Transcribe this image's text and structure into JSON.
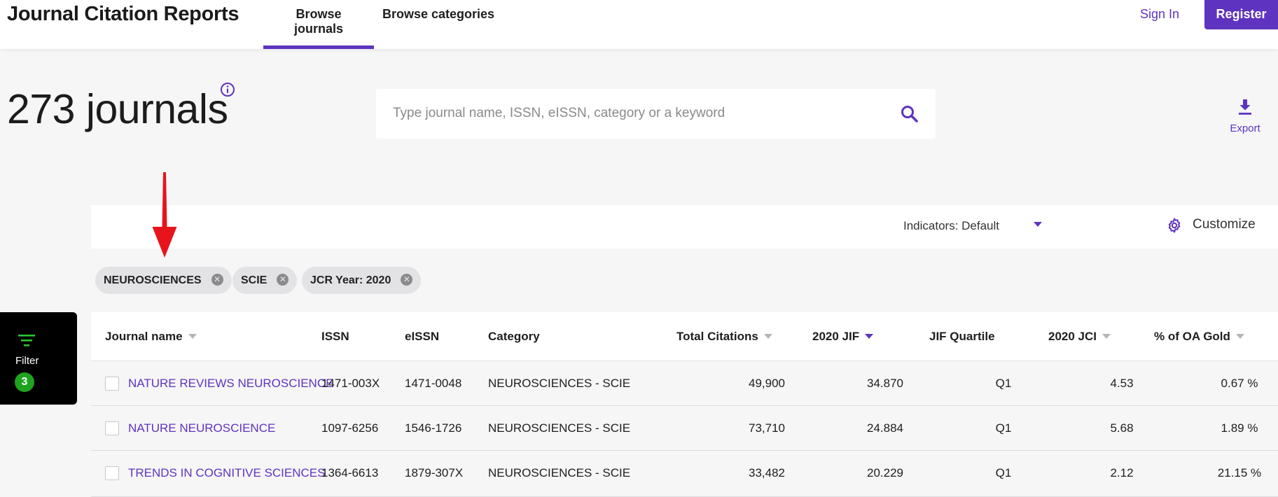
{
  "header": {
    "brand": "Journal Citation Reports",
    "tabs": [
      {
        "label": "Browse journals",
        "active": true
      },
      {
        "label": "Browse categories",
        "active": false
      }
    ],
    "sign_in": "Sign In",
    "register": "Register"
  },
  "title": {
    "count": "273 journals",
    "info_icon": "info-icon"
  },
  "search": {
    "placeholder": "Type journal name, ISSN, eISSN, category or a keyword",
    "value": ""
  },
  "export": {
    "label": "Export",
    "icon": "download-icon"
  },
  "toolbar": {
    "indicators": "Indicators: Default",
    "customize": "Customize"
  },
  "chips": [
    {
      "label": "NEUROSCIENCES"
    },
    {
      "label": "SCIE"
    },
    {
      "label": "JCR Year: 2020"
    }
  ],
  "filter": {
    "label": "Filter",
    "count": "3"
  },
  "table": {
    "columns": {
      "journal_name": "Journal name",
      "issn": "ISSN",
      "eissn": "eISSN",
      "category": "Category",
      "total_citations": "Total Citations",
      "jif": "2020 JIF",
      "jif_quartile": "JIF Quartile",
      "jci": "2020 JCI",
      "oa_gold": "% of OA Gold"
    },
    "rows": [
      {
        "name": "NATURE REVIEWS NEUROSCIENCE",
        "issn": "1471-003X",
        "eissn": "1471-0048",
        "category": "NEUROSCIENCES - SCIE",
        "citations": "49,900",
        "jif": "34.870",
        "quartile": "Q1",
        "jci": "4.53",
        "oa": "0.67 %"
      },
      {
        "name": "NATURE NEUROSCIENCE",
        "issn": "1097-6256",
        "eissn": "1546-1726",
        "category": "NEUROSCIENCES - SCIE",
        "citations": "73,710",
        "jif": "24.884",
        "quartile": "Q1",
        "jci": "5.68",
        "oa": "1.89 %"
      },
      {
        "name": "TRENDS IN COGNITIVE SCIENCES",
        "issn": "1364-6613",
        "eissn": "1879-307X",
        "category": "NEUROSCIENCES - SCIE",
        "citations": "33,482",
        "jif": "20.229",
        "quartile": "Q1",
        "jci": "2.12",
        "oa": "21.15 %"
      }
    ]
  },
  "colors": {
    "accent": "#5e33bf",
    "annotation_arrow": "#e8141b",
    "filter_badge": "#1fa31f"
  }
}
